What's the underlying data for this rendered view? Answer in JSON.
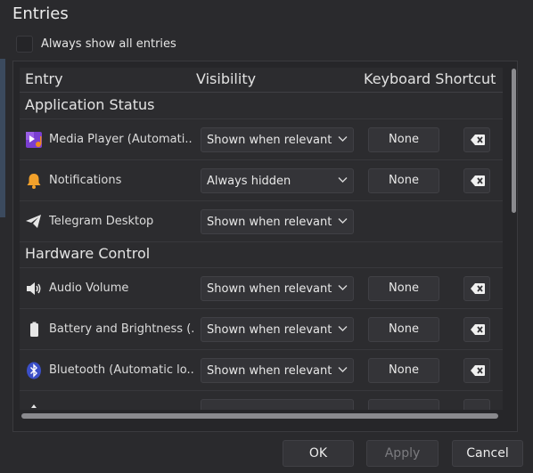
{
  "dialog": {
    "title": "Entries",
    "always_show_label": "Always show all entries"
  },
  "table": {
    "headers": {
      "entry": "Entry",
      "visibility": "Visibility",
      "shortcut": "Keyboard Shortcut"
    },
    "sections": [
      {
        "title": "Application Status",
        "rows": [
          {
            "icon": "media-player-icon",
            "label": "Media Player (Automati...",
            "visibility": "Shown when relevant",
            "shortcut": "None",
            "has_clear": true
          },
          {
            "icon": "bell-icon",
            "label": "Notifications",
            "visibility": "Always hidden",
            "shortcut": "None",
            "has_clear": true
          },
          {
            "icon": "telegram-icon",
            "label": "Telegram Desktop",
            "visibility": "Shown when relevant",
            "shortcut": "",
            "has_clear": false
          }
        ]
      },
      {
        "title": "Hardware Control",
        "rows": [
          {
            "icon": "speaker-icon",
            "label": "Audio Volume",
            "visibility": "Shown when relevant",
            "shortcut": "None",
            "has_clear": true
          },
          {
            "icon": "battery-icon",
            "label": "Battery and Brightness (...",
            "visibility": "Shown when relevant",
            "shortcut": "None",
            "has_clear": true
          },
          {
            "icon": "bluetooth-icon",
            "label": "Bluetooth (Automatic lo...",
            "visibility": "Shown when relevant",
            "shortcut": "None",
            "has_clear": true
          }
        ]
      }
    ]
  },
  "buttons": {
    "ok": "OK",
    "apply": "Apply",
    "cancel": "Cancel"
  },
  "colors": {
    "background": "#2a2a2d",
    "media_player_purple": "#7a3fd1",
    "media_player_orange": "#f08a1c",
    "bell_orange": "#f2a12b",
    "bluetooth_blue": "#3b4fc8"
  }
}
